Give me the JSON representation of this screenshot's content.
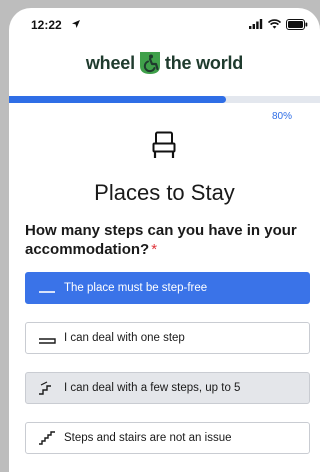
{
  "status_bar": {
    "time": "12:22",
    "location_icon": "location-arrow-icon",
    "signal_icon": "cellular-signal-icon",
    "wifi_icon": "wifi-icon",
    "battery_icon": "battery-icon"
  },
  "brand": {
    "word_left": "wheel",
    "word_right": "the world",
    "mark_icon": "wheelchair-mark-icon",
    "mark_color": "#3fa04a",
    "text_color": "#1f3b2e"
  },
  "progress": {
    "label": "80%",
    "value": 0.8,
    "color": "#2f6ee6"
  },
  "section": {
    "icon": "bed-icon",
    "title": "Places to Stay"
  },
  "question": {
    "text": "How many steps can you have in your accommodation?",
    "required_marker": "*"
  },
  "options": [
    {
      "label": "The place must be step-free",
      "icon": "flat-line-icon",
      "state": "selected"
    },
    {
      "label": "I can deal with one step",
      "icon": "one-step-icon",
      "state": "default"
    },
    {
      "label": "I can deal with a few steps, up to 5",
      "icon": "few-steps-icon",
      "state": "hovered"
    },
    {
      "label": "Steps and stairs are not an issue",
      "icon": "stairs-icon",
      "state": "default"
    }
  ],
  "colors": {
    "accent": "#3a73e8",
    "required": "#e0343a"
  }
}
